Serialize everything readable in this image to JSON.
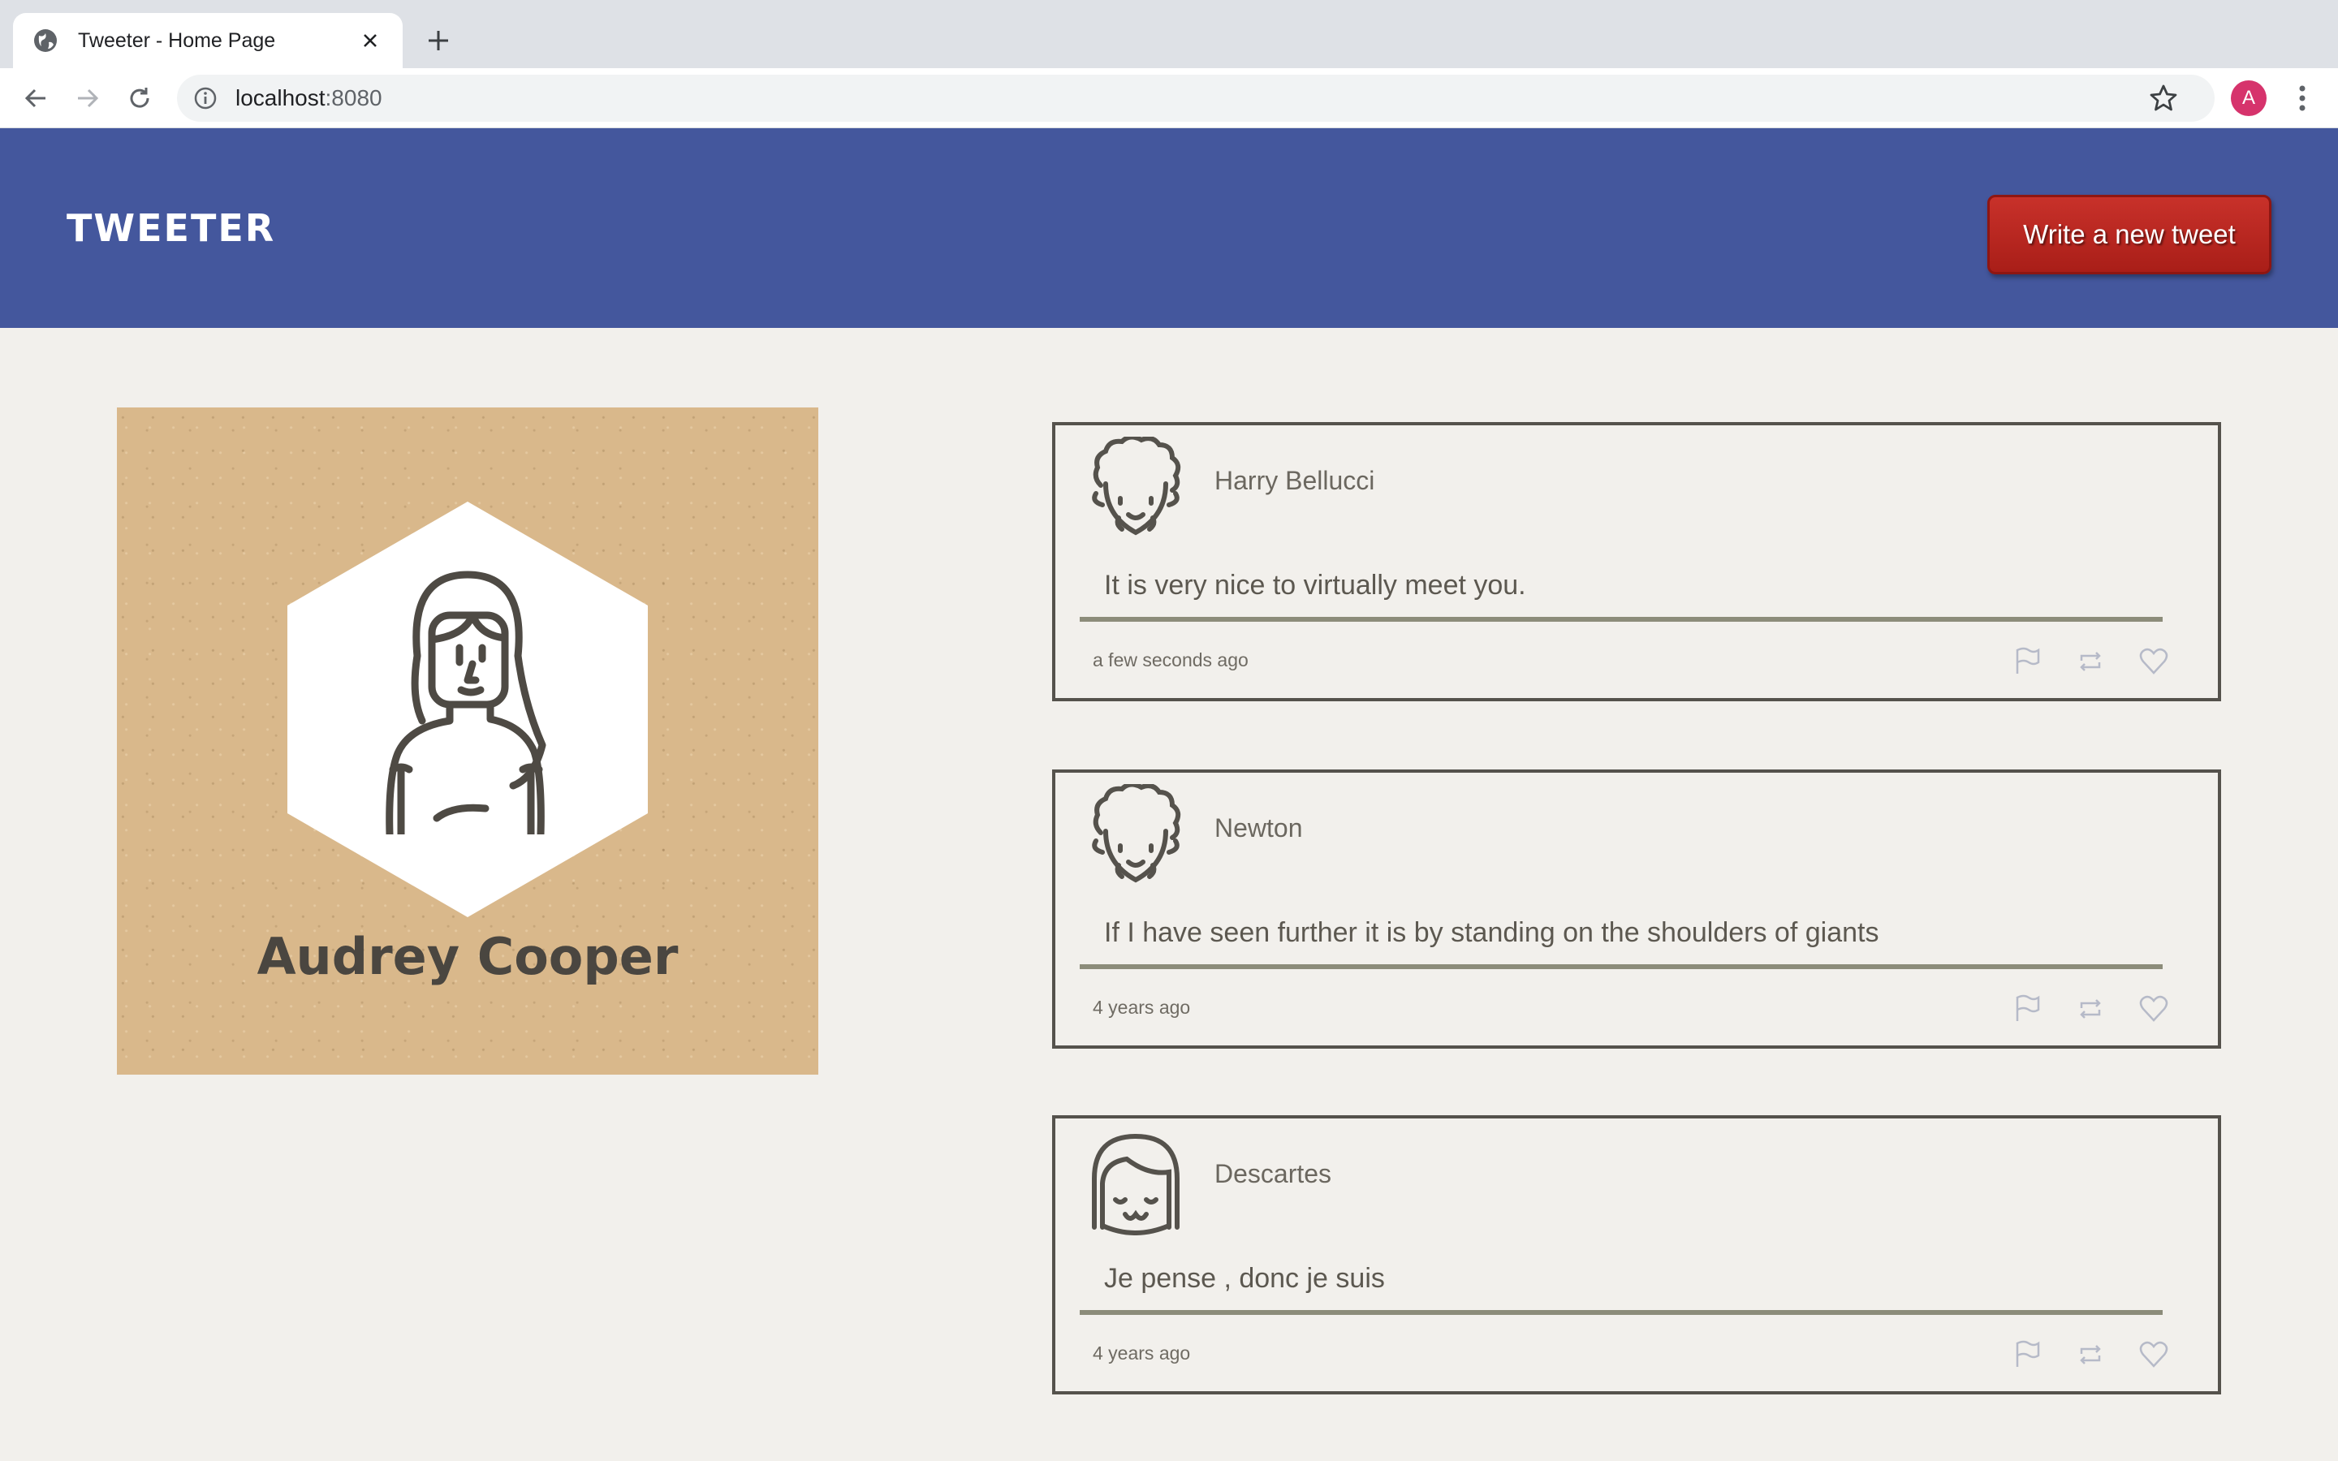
{
  "browser": {
    "tab_title": "Tweeter - Home Page",
    "url_host": "localhost",
    "url_port": ":8080",
    "profile_initial": "A"
  },
  "header": {
    "brand": "TWEETER",
    "write_button": "Write a new tweet",
    "colors": {
      "bar": "#44579d",
      "button": "#b52620"
    }
  },
  "profile": {
    "name": "Audrey Cooper",
    "avatar_icon": "woman-avatar-icon"
  },
  "tweets": [
    {
      "author": "Harry Bellucci",
      "text": "It is very nice to virtually meet you.",
      "time": "a few seconds ago",
      "avatar_icon": "curly-man-avatar-icon"
    },
    {
      "author": "Newton",
      "text": "If I have seen further it is by standing on the shoulders of giants",
      "time": "4 years ago",
      "avatar_icon": "curly-man-avatar-icon"
    },
    {
      "author": "Descartes",
      "text": "Je pense , donc je suis",
      "time": "4 years ago",
      "avatar_icon": "bob-hair-avatar-icon"
    }
  ],
  "tweet_actions": [
    "flag-icon",
    "retweet-icon",
    "heart-icon"
  ]
}
